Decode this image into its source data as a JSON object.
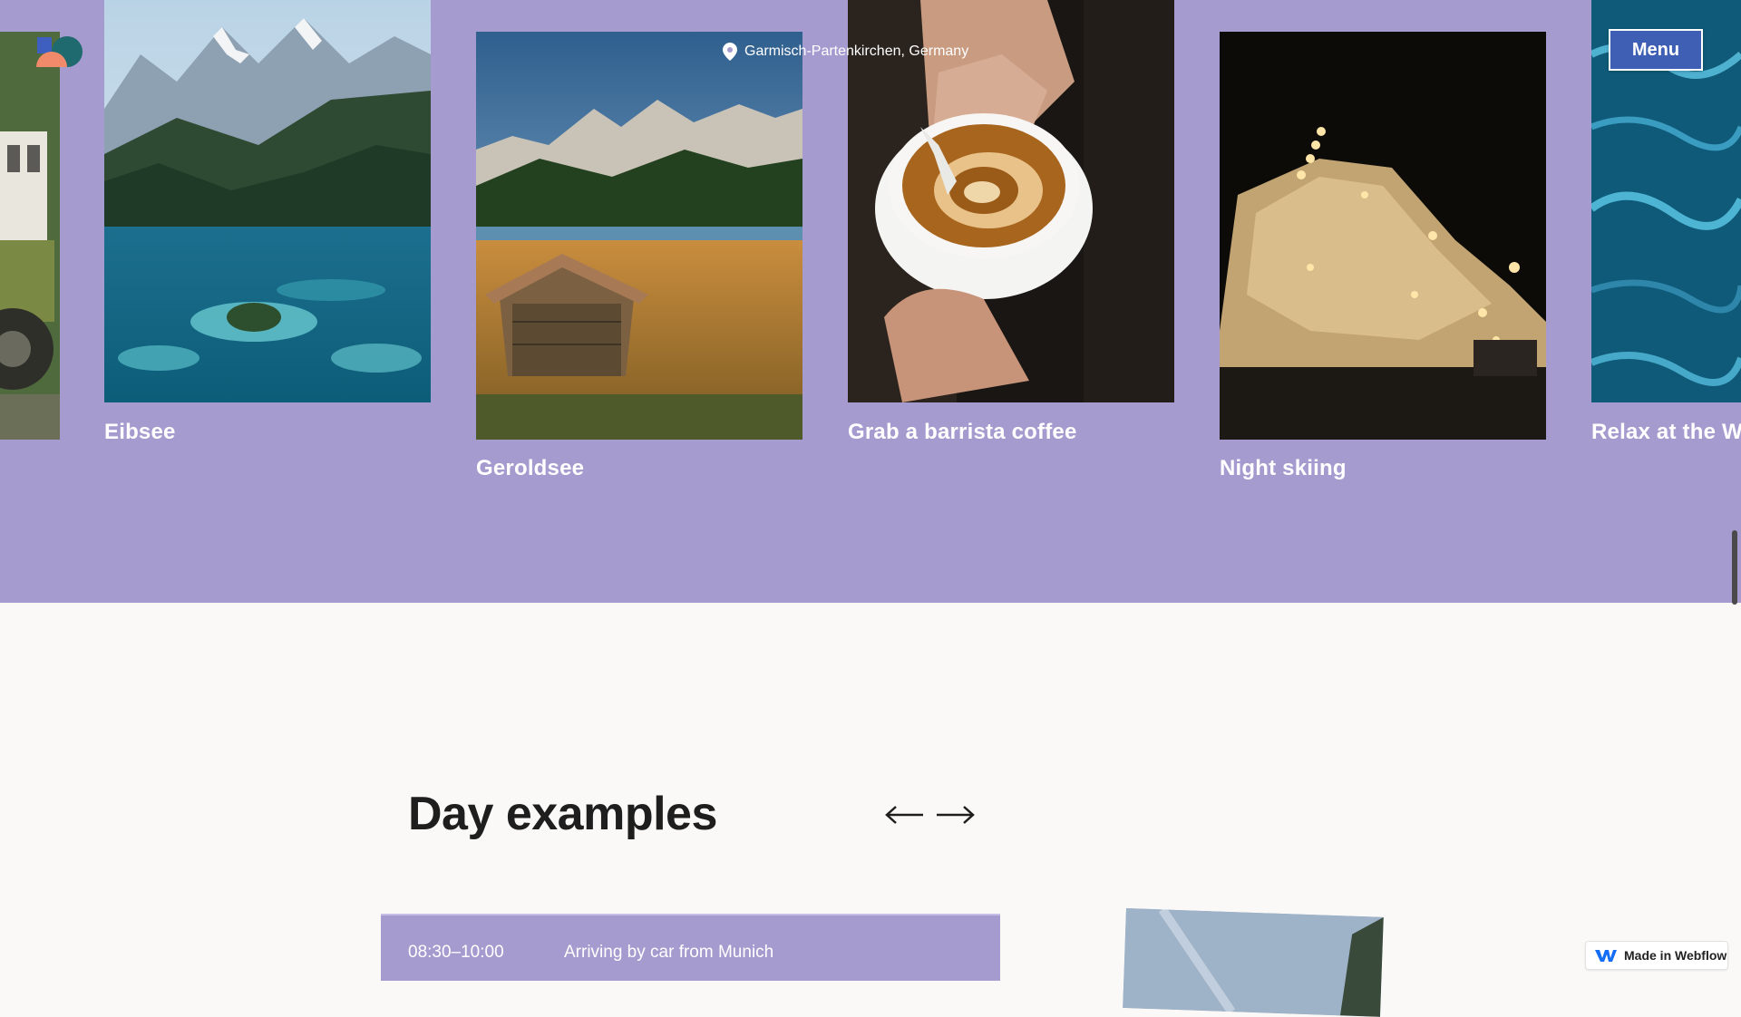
{
  "header": {
    "location": "Garmisch-Partenkirchen, Germany",
    "menu_label": "Menu"
  },
  "cards": [
    {
      "caption": ""
    },
    {
      "caption": "Eibsee"
    },
    {
      "caption": "Geroldsee"
    },
    {
      "caption": "Grab a barrista coffee"
    },
    {
      "caption": "Night skiing"
    },
    {
      "caption": "Relax at the W"
    }
  ],
  "day_examples": {
    "title": "Day examples",
    "prev_icon": "arrow-left-icon",
    "next_icon": "arrow-right-icon",
    "schedule": [
      {
        "time": "08:30–10:00",
        "desc": "Arriving by car from Munich"
      }
    ]
  },
  "webflow_badge": {
    "label": "Made in Webflow",
    "icon": "webflow-logo-icon"
  },
  "colors": {
    "hero_bg": "#a59bcf",
    "page_bg": "#faf9f7",
    "menu_button": "#3e5fb4"
  }
}
